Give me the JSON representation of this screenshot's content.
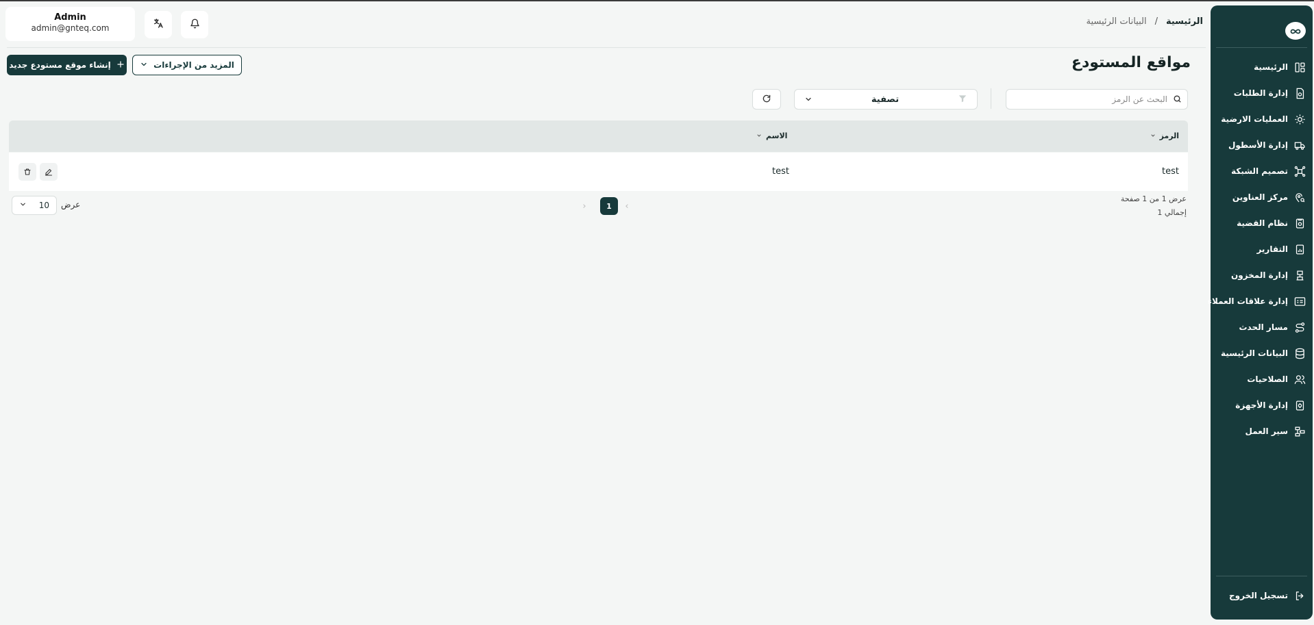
{
  "header": {
    "user_name": "Admin",
    "user_email": "admin@gnteq.com",
    "breadcrumb": {
      "home": "الرئيسية",
      "separator": "/",
      "current": "البيانات الرئيسية"
    }
  },
  "page": {
    "title": "مواقع المستودع",
    "primary_button": "إنشاء موقع مستودع جديد",
    "more_actions": "المزيد من الإجراءات",
    "search_placeholder": "البحث عن الرمز",
    "filter_label": "تصفية"
  },
  "table": {
    "columns": [
      {
        "key": "code",
        "label": "الرمز"
      },
      {
        "key": "name",
        "label": "الاسم"
      }
    ],
    "rows": [
      {
        "code": "test",
        "name": "test"
      }
    ]
  },
  "pagination": {
    "info": "عرض 1 من 1 صفحة",
    "total": "إجمالي 1",
    "current_page": "1",
    "per_page": "10",
    "per_page_label": "عرض"
  },
  "sidebar": {
    "items": [
      {
        "label": "الرئيسية",
        "icon": "dashboard-icon"
      },
      {
        "label": "إدارة الطلبات",
        "icon": "orders-icon"
      },
      {
        "label": "العمليات الارضية",
        "icon": "ground-ops-icon"
      },
      {
        "label": "إدارة الأسطول",
        "icon": "truck-icon"
      },
      {
        "label": "تصميم الشبكة",
        "icon": "network-icon"
      },
      {
        "label": "مركز العناوين",
        "icon": "location-icon"
      },
      {
        "label": "نظام القضية",
        "icon": "case-icon"
      },
      {
        "label": "التقارير",
        "icon": "reports-icon"
      },
      {
        "label": "إدارة المخزون",
        "icon": "inventory-icon"
      },
      {
        "label": "إدارة علاقات العملاء",
        "icon": "crm-icon"
      },
      {
        "label": "مسار الحدث",
        "icon": "event-path-icon"
      },
      {
        "label": "البيانات الرئيسية",
        "icon": "database-icon"
      },
      {
        "label": "الصلاحيات",
        "icon": "users-icon"
      },
      {
        "label": "إدارة الأجهزة",
        "icon": "devices-icon"
      },
      {
        "label": "سير العمل",
        "icon": "workflow-icon"
      }
    ],
    "logout": "تسجيل الخروج"
  }
}
